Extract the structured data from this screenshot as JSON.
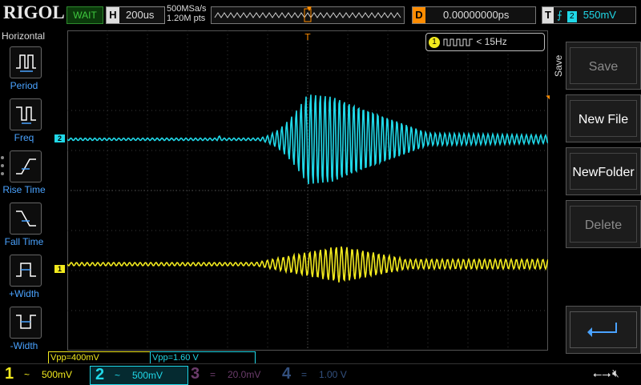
{
  "topbar": {
    "logo": "RIGOL",
    "run_status": "WAIT",
    "horizontal_key": "H",
    "timebase": "200us",
    "sample_rate": "500MSa/s",
    "memory_depth": "1.20M pts",
    "delay_key": "D",
    "delay_value": "0.00000000ps",
    "trigger_key": "T",
    "trigger_source": "2",
    "trigger_level": "550mV"
  },
  "left_menu": {
    "title": "Horizontal",
    "items": [
      {
        "label": "Period",
        "icon": "period-icon"
      },
      {
        "label": "Freq",
        "icon": "frequency-icon"
      },
      {
        "label": "Rise Time",
        "icon": "rise-time-icon"
      },
      {
        "label": "Fall Time",
        "icon": "fall-time-icon"
      },
      {
        "label": "+Width",
        "icon": "positive-width-icon"
      },
      {
        "label": "-Width",
        "icon": "negative-width-icon"
      }
    ]
  },
  "screen": {
    "freq_counter_channel": "1",
    "freq_counter_value": "< 15Hz",
    "ch1_marker": "1",
    "ch2_marker": "2"
  },
  "measurements": {
    "ch1": "Vpp=400mV",
    "ch2": "Vpp=1.60 V"
  },
  "right_menu": {
    "title": "Save",
    "buttons": [
      {
        "label": "Save",
        "enabled": false
      },
      {
        "label": "New File",
        "enabled": true
      },
      {
        "label": "NewFolder",
        "enabled": true
      },
      {
        "label": "Delete",
        "enabled": false
      }
    ],
    "back_icon": "return-arrow-icon"
  },
  "channels": [
    {
      "num": "1",
      "coupling": "~",
      "scale": "500mV",
      "color": "#f2ea1e",
      "active": false
    },
    {
      "num": "2",
      "coupling": "~",
      "scale": "500mV",
      "color": "#20d8e8",
      "active": true
    },
    {
      "num": "3",
      "coupling": "=",
      "scale": "20.0mV",
      "color": "#6b3c6b",
      "active": false
    },
    {
      "num": "4",
      "coupling": "=",
      "scale": "1.00 V",
      "color": "#33507e",
      "active": false
    }
  ],
  "status_icons": [
    "usb-icon",
    "speaker-muted-icon"
  ],
  "colors": {
    "ch1": "#f2ea1e",
    "ch2": "#20d8e8",
    "trigger": "#ff8c00",
    "menu_label": "#4aa3ff"
  }
}
